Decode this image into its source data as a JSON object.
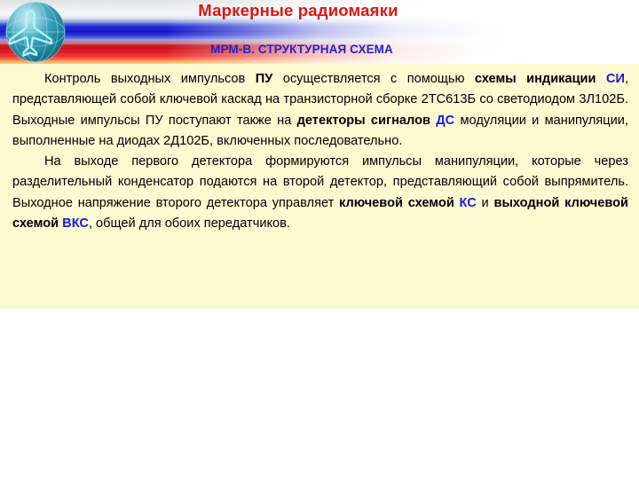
{
  "slide": {
    "header": {
      "title": "Маркерные радиомаяки",
      "subtitle": "МРМ-В. СТРУКТУРНАЯ СХЕМА",
      "logo_icon": "airplane-globe-icon",
      "flag_icon": "russian-flag-banner",
      "title_color": "#e11414",
      "subtitle_color": "#2222cc"
    },
    "body": {
      "background_color": "#fbfbd2",
      "paragraph1": {
        "p1_t1": "Контроль выходных импульсов ",
        "p1_b1": "ПУ",
        "p1_t2": " осуществляется с помощью ",
        "p1_b2": "схемы индикации ",
        "p1_bb1": "СИ",
        "p1_t3": ", представляющей собой ключевой каскад на транзисторной сборке 2ТС613Б со светодиодом 3Л102Б. Выходные импульсы ПУ поступают также на ",
        "p1_b3": "детекторы сигналов ",
        "p1_bb2": "ДС",
        "p1_t4": " модуляции и манипуляции, выполненные на диодах 2Д102Б, включенных последовательно."
      },
      "paragraph2": {
        "p2_t1": "На выходе первого детектора формируются импульсы манипуляции, которые через разделительный конденсатор подаются на второй детектор, представляющий собой выпрямитель. Выходное напряжение второго детектора управляет ",
        "p2_b1": "ключевой схемой ",
        "p2_bb1": "КС",
        "p2_t2": " и ",
        "p2_b2": "выходной ключевой схемой ",
        "p2_bb2": "ВКС",
        "p2_t3": ", общей для обоих передатчиков."
      }
    }
  }
}
